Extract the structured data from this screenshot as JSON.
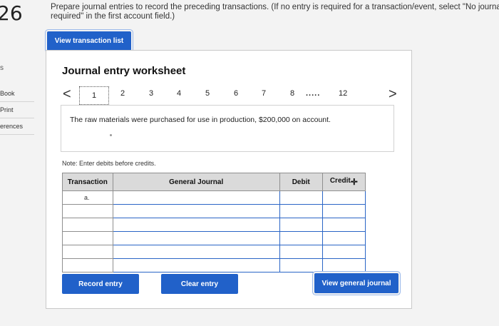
{
  "question_number": "26",
  "instructions": {
    "line1": "Prepare journal entries to record the preceding transactions. (If no entry is required for a transaction/event, select \"No journal entry",
    "line2": "required\" in the first account field.)"
  },
  "left_mark": "s",
  "sidebar": {
    "items": [
      {
        "label": "Book"
      },
      {
        "label": "Print"
      },
      {
        "label": "erences"
      }
    ]
  },
  "buttons": {
    "view_transaction_list": "View transaction list",
    "record_entry": "Record entry",
    "clear_entry": "Clear entry",
    "view_general_journal": "View general journal"
  },
  "worksheet": {
    "title": "Journal entry worksheet",
    "prev_arrow": "<",
    "next_arrow": ">",
    "pages": [
      "1",
      "2",
      "3",
      "4",
      "5",
      "6",
      "7",
      "8"
    ],
    "ellipsis": ".....",
    "last_page": "12",
    "active_page": "1",
    "description": "The raw materials were purchased for use in production, $200,000 on account.",
    "note": "Note: Enter debits before credits."
  },
  "table": {
    "headers": {
      "transaction": "Transaction",
      "general_journal": "General Journal",
      "debit": "Debit",
      "credit": "Credit"
    },
    "first_row_label": "a."
  },
  "colors": {
    "button_blue": "#2161c9",
    "input_border": "#2a65c6",
    "header_gray": "#dadada"
  }
}
